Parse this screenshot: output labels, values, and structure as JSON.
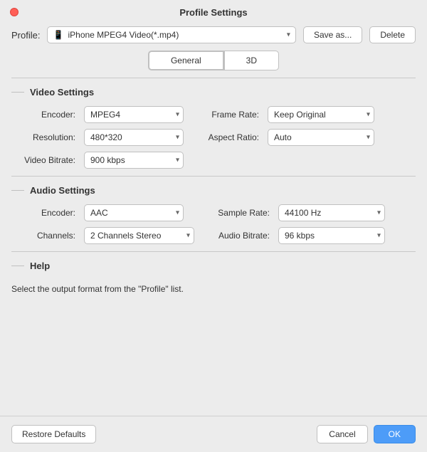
{
  "window": {
    "title": "Profile Settings"
  },
  "profile": {
    "label": "Profile:",
    "value": "iPhone MPEG4 Video(*.mp4)",
    "icon": "📱",
    "save_label": "Save as...",
    "delete_label": "Delete"
  },
  "tabs": [
    {
      "label": "General",
      "active": true
    },
    {
      "label": "3D",
      "active": false
    }
  ],
  "video_settings": {
    "title": "Video Settings",
    "fields": [
      {
        "label": "Encoder:",
        "value": "MPEG4"
      },
      {
        "label": "Resolution:",
        "value": "480*320"
      },
      {
        "label": "Video Bitrate:",
        "value": "900 kbps"
      }
    ],
    "right_fields": [
      {
        "label": "Frame Rate:",
        "value": "Keep Original"
      },
      {
        "label": "Aspect Ratio:",
        "value": "Auto"
      }
    ]
  },
  "audio_settings": {
    "title": "Audio Settings",
    "fields": [
      {
        "label": "Encoder:",
        "value": "AAC"
      },
      {
        "label": "Channels:",
        "value": "2 Channels Stereo"
      }
    ],
    "right_fields": [
      {
        "label": "Sample Rate:",
        "value": "44100 Hz"
      },
      {
        "label": "Audio Bitrate:",
        "value": "96 kbps"
      }
    ]
  },
  "help": {
    "title": "Help",
    "text": "Select the output format from the \"Profile\" list."
  },
  "footer": {
    "restore_label": "Restore Defaults",
    "cancel_label": "Cancel",
    "ok_label": "OK"
  }
}
